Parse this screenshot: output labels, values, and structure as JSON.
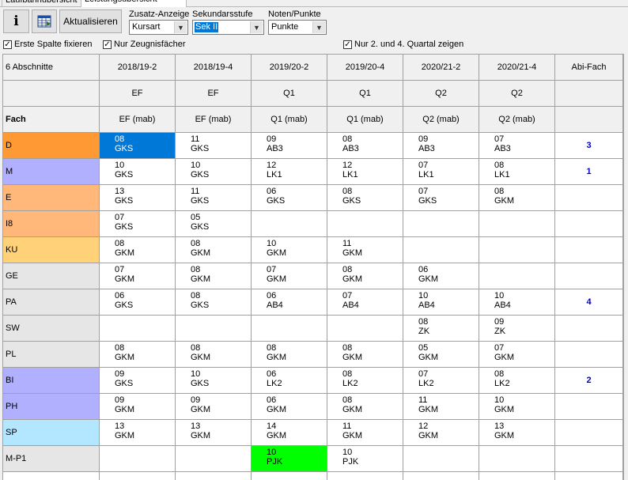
{
  "tabs": [
    "Laufbahnübersicht",
    "Leistungsübersicht"
  ],
  "toolbar": {
    "info_label": "i",
    "refresh_label": "Aktualisieren",
    "zusatz_label": "Zusatz-Anzeige",
    "zusatz_value": "Kursart",
    "sek_label": "Sekundarsstufe",
    "sek_value": "Sek II",
    "noten_label": "Noten/Punkte",
    "noten_value": "Punkte",
    "chk_first_col": "Erste Spalte fixieren",
    "chk_zeugnis": "Nur Zeugnisfächer",
    "chk_quartal": "Nur 2. und 4. Quartal zeigen"
  },
  "colors": {
    "selected": "#0078d7",
    "green": "#00ff00",
    "abi_text": "#0000c8"
  },
  "grid": {
    "corner": "6 Abschnitte",
    "fach_label": "Fach",
    "columns": [
      {
        "period": "2018/19-2",
        "stage": "EF",
        "detail": "EF (mab)"
      },
      {
        "period": "2018/19-4",
        "stage": "EF",
        "detail": "EF (mab)"
      },
      {
        "period": "2019/20-2",
        "stage": "Q1",
        "detail": "Q1 (mab)"
      },
      {
        "period": "2019/20-4",
        "stage": "Q1",
        "detail": "Q1 (mab)"
      },
      {
        "period": "2020/21-2",
        "stage": "Q2",
        "detail": "Q2 (mab)"
      },
      {
        "period": "2020/21-4",
        "stage": "Q2",
        "detail": "Q2 (mab)"
      }
    ],
    "abi_header": "Abi-Fach",
    "rows": [
      {
        "subject": "D",
        "color": "#ff9933",
        "abi": "3",
        "cells": [
          [
            "08",
            "GKS"
          ],
          [
            "11",
            "GKS"
          ],
          [
            "09",
            "AB3"
          ],
          [
            "08",
            "AB3"
          ],
          [
            "09",
            "AB3"
          ],
          [
            "07",
            "AB3"
          ]
        ]
      },
      {
        "subject": "M",
        "color": "#b0b0ff",
        "abi": "1",
        "cells": [
          [
            "10",
            "GKS"
          ],
          [
            "10",
            "GKS"
          ],
          [
            "12",
            "LK1"
          ],
          [
            "12",
            "LK1"
          ],
          [
            "07",
            "LK1"
          ],
          [
            "08",
            "LK1"
          ]
        ]
      },
      {
        "subject": "E",
        "color": "#ffb77a",
        "abi": "",
        "cells": [
          [
            "13",
            "GKS"
          ],
          [
            "11",
            "GKS"
          ],
          [
            "06",
            "GKS"
          ],
          [
            "08",
            "GKS"
          ],
          [
            "07",
            "GKS"
          ],
          [
            "08",
            "GKM"
          ]
        ]
      },
      {
        "subject": "I8",
        "color": "#ffb77a",
        "abi": "",
        "cells": [
          [
            "07",
            "GKS"
          ],
          [
            "05",
            "GKS"
          ],
          null,
          null,
          null,
          null
        ]
      },
      {
        "subject": "KU",
        "color": "#ffd27a",
        "abi": "",
        "cells": [
          [
            "08",
            "GKM"
          ],
          [
            "08",
            "GKM"
          ],
          [
            "10",
            "GKM"
          ],
          [
            "11",
            "GKM"
          ],
          null,
          null
        ]
      },
      {
        "subject": "GE",
        "color": "#e6e6e6",
        "abi": "",
        "cells": [
          [
            "07",
            "GKM"
          ],
          [
            "08",
            "GKM"
          ],
          [
            "07",
            "GKM"
          ],
          [
            "08",
            "GKM"
          ],
          [
            "06",
            "GKM"
          ],
          null
        ]
      },
      {
        "subject": "PA",
        "color": "#e6e6e6",
        "abi": "4",
        "cells": [
          [
            "06",
            "GKS"
          ],
          [
            "08",
            "GKS"
          ],
          [
            "06",
            "AB4"
          ],
          [
            "07",
            "AB4"
          ],
          [
            "10",
            "AB4"
          ],
          [
            "10",
            "AB4"
          ]
        ]
      },
      {
        "subject": "SW",
        "color": "#e6e6e6",
        "abi": "",
        "cells": [
          null,
          null,
          null,
          null,
          [
            "08",
            "ZK"
          ],
          [
            "09",
            "ZK"
          ]
        ]
      },
      {
        "subject": "PL",
        "color": "#e6e6e6",
        "abi": "",
        "cells": [
          [
            "08",
            "GKM"
          ],
          [
            "08",
            "GKM"
          ],
          [
            "08",
            "GKM"
          ],
          [
            "08",
            "GKM"
          ],
          [
            "05",
            "GKM"
          ],
          [
            "07",
            "GKM"
          ]
        ]
      },
      {
        "subject": "BI",
        "color": "#b0b0ff",
        "abi": "2",
        "cells": [
          [
            "09",
            "GKS"
          ],
          [
            "10",
            "GKS"
          ],
          [
            "06",
            "LK2"
          ],
          [
            "08",
            "LK2"
          ],
          [
            "07",
            "LK2"
          ],
          [
            "08",
            "LK2"
          ]
        ]
      },
      {
        "subject": "PH",
        "color": "#b0b0ff",
        "abi": "",
        "cells": [
          [
            "09",
            "GKM"
          ],
          [
            "09",
            "GKM"
          ],
          [
            "06",
            "GKM"
          ],
          [
            "08",
            "GKM"
          ],
          [
            "11",
            "GKM"
          ],
          [
            "10",
            "GKM"
          ]
        ]
      },
      {
        "subject": "SP",
        "color": "#b3e6ff",
        "abi": "",
        "cells": [
          [
            "13",
            "GKM"
          ],
          [
            "13",
            "GKM"
          ],
          [
            "14",
            "GKM"
          ],
          [
            "11",
            "GKM"
          ],
          [
            "12",
            "GKM"
          ],
          [
            "13",
            "GKM"
          ]
        ]
      },
      {
        "subject": "M-P1",
        "color": "#e6e6e6",
        "abi": "",
        "cells": [
          null,
          null,
          [
            "10",
            "PJK"
          ],
          [
            "10",
            "PJK"
          ],
          null,
          null
        ]
      }
    ],
    "highlights": [
      {
        "row": 0,
        "col": 0,
        "bg": "#0078d7",
        "fg": "#ffffff"
      },
      {
        "row": 12,
        "col": 2,
        "bg": "#00ff00",
        "fg": "#000000"
      }
    ]
  }
}
